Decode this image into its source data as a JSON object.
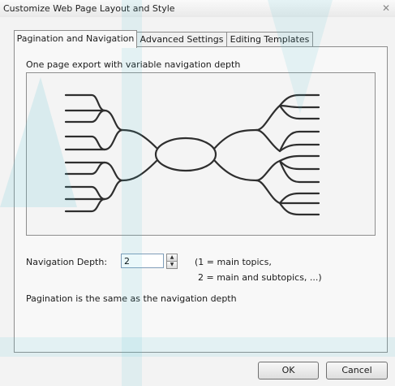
{
  "window": {
    "title": "Customize Web Page Layout and Style",
    "close_icon": "close-icon"
  },
  "tabs": [
    {
      "label": "Pagination and Navigation",
      "active": true
    },
    {
      "label": "Advanced Settings",
      "active": false
    },
    {
      "label": "Editing Templates",
      "active": false
    }
  ],
  "panel": {
    "caption": "One page export with variable navigation depth",
    "preview": "mind-map-diagram"
  },
  "navigation": {
    "label": "Navigation Depth:",
    "value": "2",
    "hint_line1": "(1 = main topics,",
    "hint_line2": "2 = main and subtopics, ...)"
  },
  "pagination_note": "Pagination is the same as the navigation depth",
  "buttons": {
    "ok": "OK",
    "cancel": "Cancel"
  },
  "colors": {
    "watermark": "#4fc3d6"
  }
}
